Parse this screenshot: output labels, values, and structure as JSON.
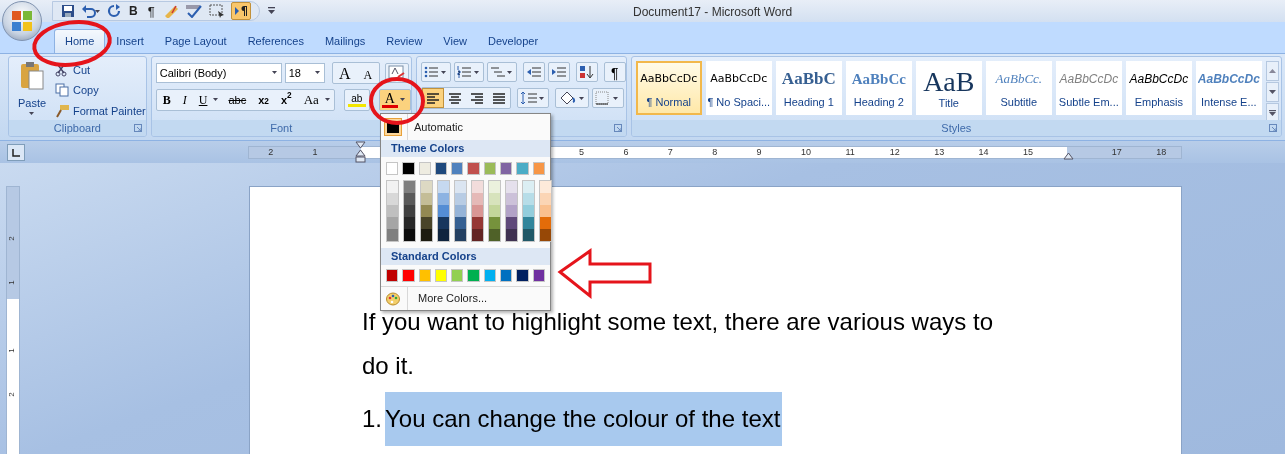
{
  "title_bar": {
    "title": "Document17 - Microsoft Word"
  },
  "quick_access": {
    "bold": "B",
    "paragraph": "¶",
    "show_hide_on": true
  },
  "tabs": [
    {
      "label": "Home",
      "selected": true
    },
    {
      "label": "Insert",
      "selected": false
    },
    {
      "label": "Page Layout",
      "selected": false
    },
    {
      "label": "References",
      "selected": false
    },
    {
      "label": "Mailings",
      "selected": false
    },
    {
      "label": "Review",
      "selected": false
    },
    {
      "label": "View",
      "selected": false
    },
    {
      "label": "Developer",
      "selected": false
    }
  ],
  "clipboard": {
    "paste": "Paste",
    "cut": "Cut",
    "copy": "Copy",
    "format_painter": "Format Painter",
    "label": "Clipboard"
  },
  "font": {
    "font_name": "Calibri (Body)",
    "font_size": "18",
    "grow": "A",
    "shrink": "A",
    "buttons": [
      "B",
      "I",
      "U",
      "abc",
      "x$_{2}$",
      "x$^{2}$",
      "Aa"
    ],
    "highlight": "ab",
    "font_color": "A",
    "label": "Font"
  },
  "paragraph": {
    "sort": "¶",
    "alignment": [
      {
        "selected": true
      },
      {
        "selected": false
      },
      {
        "selected": false
      },
      {
        "selected": false
      }
    ]
  },
  "styles": {
    "label": "Styles",
    "items": [
      {
        "kind": "normal",
        "preview": "AaBbCcDc",
        "label": "¶ Normal",
        "selected": true
      },
      {
        "kind": "normal",
        "preview": "AaBbCcDc",
        "label": "¶ No Spaci...",
        "selected": false
      },
      {
        "kind": "heading1",
        "preview": "AaBbC",
        "label": "Heading 1",
        "selected": false
      },
      {
        "kind": "heading2",
        "preview": "AaBbCc",
        "label": "Heading 2",
        "selected": false
      },
      {
        "kind": "title",
        "preview": "AaB",
        "label": "Title",
        "selected": false
      },
      {
        "kind": "subtitle",
        "preview": "AaBbCc.",
        "label": "Subtitle",
        "selected": false
      },
      {
        "kind": "subtle",
        "preview": "AaBbCcDc",
        "label": "Subtle Em...",
        "selected": false
      },
      {
        "kind": "emphasis",
        "preview": "AaBbCcDc",
        "label": "Emphasis",
        "selected": false
      },
      {
        "kind": "intense",
        "preview": "AaBbCcDc",
        "label": "Intense E...",
        "selected": false
      }
    ]
  },
  "ruler": {
    "left_labels": [
      "2",
      "1"
    ],
    "right_labels": [
      "5",
      "6",
      "7",
      "8",
      "9",
      "10",
      "11",
      "12",
      "13",
      "14",
      "15"
    ],
    "far_labels": [
      "17",
      "18"
    ]
  },
  "vertical_ruler": {
    "labels": [
      "2",
      "1",
      "1",
      "2"
    ]
  },
  "color_menu": {
    "automatic": {
      "label": "Automatic",
      "selected": true
    },
    "theme_label": "Theme Colors",
    "theme_colors": [
      {
        "color": "#ffffff",
        "shades": [
          {
            "color": "#f2f2f2"
          },
          {
            "color": "#d8d8d8"
          },
          {
            "color": "#bfbfbf"
          },
          {
            "color": "#a5a5a5"
          },
          {
            "color": "#7f7f7f"
          }
        ]
      },
      {
        "color": "#000000",
        "shades": [
          {
            "color": "#7f7f7f"
          },
          {
            "color": "#595959"
          },
          {
            "color": "#3f3f3f"
          },
          {
            "color": "#262626"
          },
          {
            "color": "#0c0c0c"
          }
        ]
      },
      {
        "color": "#eeece1",
        "shades": [
          {
            "color": "#ddd9c3"
          },
          {
            "color": "#c4bd97"
          },
          {
            "color": "#938953"
          },
          {
            "color": "#494429"
          },
          {
            "color": "#1d1b10"
          }
        ]
      },
      {
        "color": "#1f497d",
        "shades": [
          {
            "color": "#c6d9f0"
          },
          {
            "color": "#8db3e2"
          },
          {
            "color": "#548dd4"
          },
          {
            "color": "#17365d"
          },
          {
            "color": "#0f243e"
          }
        ]
      },
      {
        "color": "#4f81bd",
        "shades": [
          {
            "color": "#dbe5f1"
          },
          {
            "color": "#b8cce4"
          },
          {
            "color": "#95b3d7"
          },
          {
            "color": "#366092"
          },
          {
            "color": "#244061"
          }
        ]
      },
      {
        "color": "#c0504d",
        "shades": [
          {
            "color": "#f2dcdb"
          },
          {
            "color": "#e5b9b7"
          },
          {
            "color": "#d99694"
          },
          {
            "color": "#953734"
          },
          {
            "color": "#632423"
          }
        ]
      },
      {
        "color": "#9bbb59",
        "shades": [
          {
            "color": "#ebf1dd"
          },
          {
            "color": "#d7e3bc"
          },
          {
            "color": "#c3d69b"
          },
          {
            "color": "#76923c"
          },
          {
            "color": "#4f6128"
          }
        ]
      },
      {
        "color": "#8064a2",
        "shades": [
          {
            "color": "#e5e0ec"
          },
          {
            "color": "#ccc1d9"
          },
          {
            "color": "#b2a2c7"
          },
          {
            "color": "#5f497a"
          },
          {
            "color": "#3f3151"
          }
        ]
      },
      {
        "color": "#4bacc6",
        "shades": [
          {
            "color": "#dbeef3"
          },
          {
            "color": "#b7dde8"
          },
          {
            "color": "#92cddc"
          },
          {
            "color": "#31859b"
          },
          {
            "color": "#205867"
          }
        ]
      },
      {
        "color": "#f79646",
        "shades": [
          {
            "color": "#fdeada"
          },
          {
            "color": "#fbd5b5"
          },
          {
            "color": "#fac08f"
          },
          {
            "color": "#e36c09"
          },
          {
            "color": "#974806"
          }
        ]
      }
    ],
    "standard_label": "Standard Colors",
    "standard_colors": [
      {
        "color": "#c00000"
      },
      {
        "color": "#ff0000"
      },
      {
        "color": "#ffc000"
      },
      {
        "color": "#ffff00"
      },
      {
        "color": "#92d050"
      },
      {
        "color": "#00b050"
      },
      {
        "color": "#00b0f0"
      },
      {
        "color": "#0070c0"
      },
      {
        "color": "#002060"
      },
      {
        "color": "#7030a0"
      }
    ],
    "more_colors": "More Colors..."
  },
  "document": {
    "paragraphs": [
      {
        "kind": "text",
        "text": "If you want to highlight some text, there are various ways to do it."
      },
      {
        "kind": "list_item",
        "number": "1.",
        "text": "You can change the colour of the text",
        "highlighted": true
      }
    ]
  }
}
